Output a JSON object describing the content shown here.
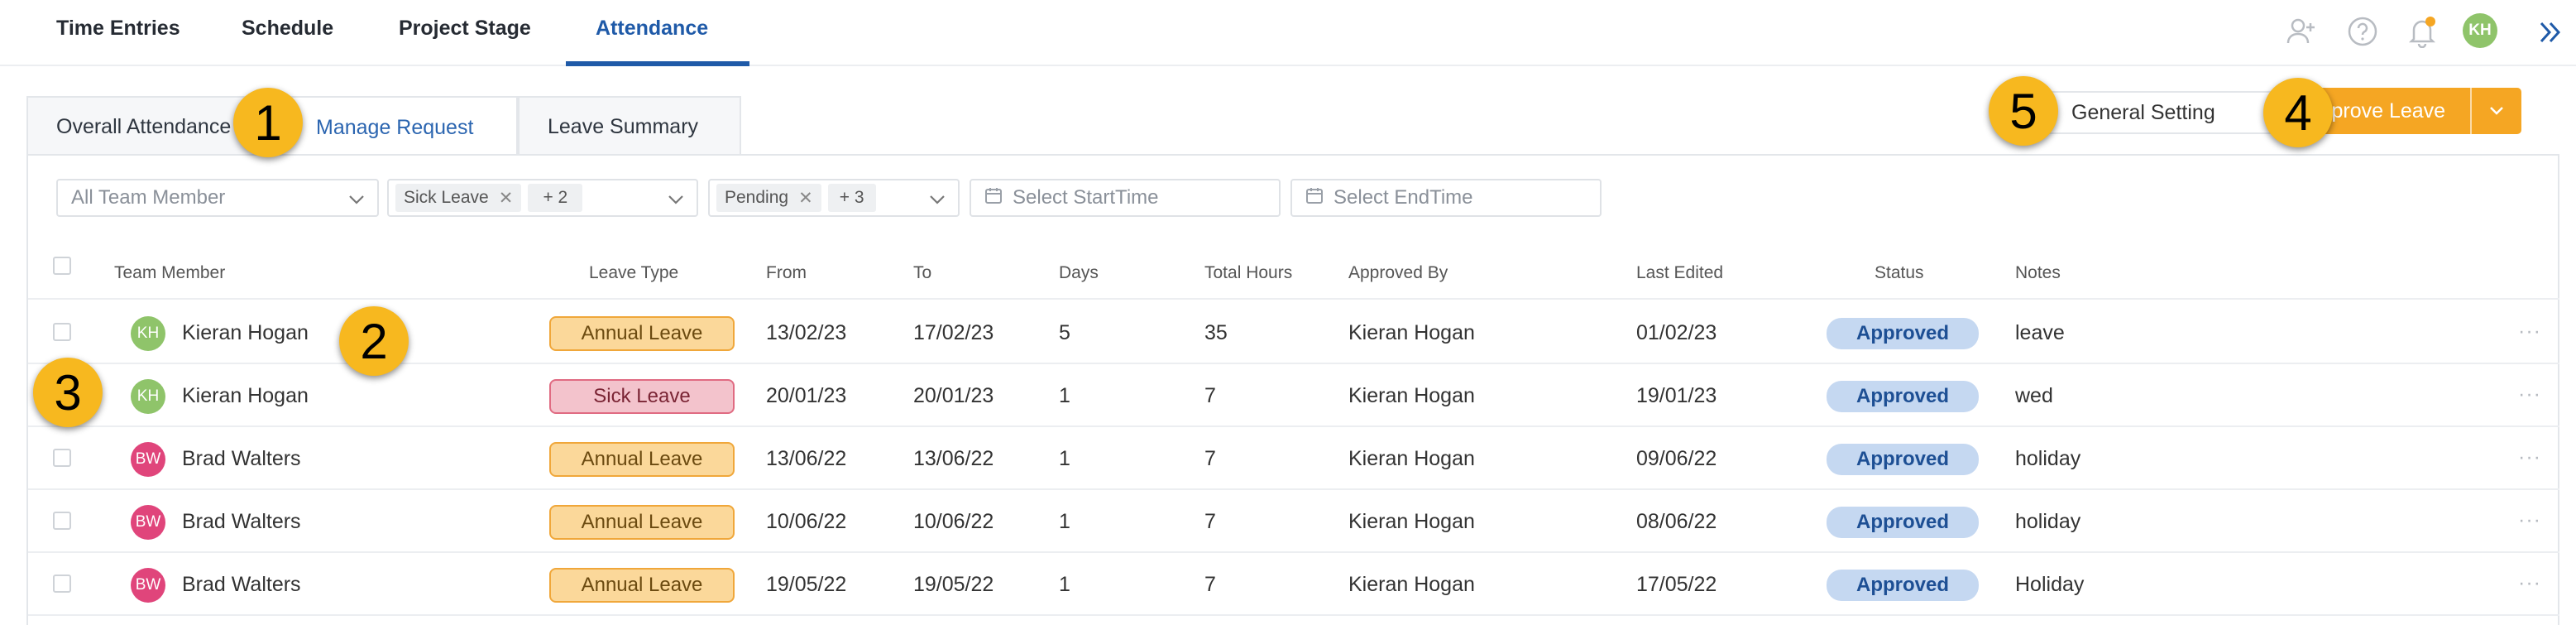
{
  "nav": {
    "items": [
      "Time Entries",
      "Schedule",
      "Project Stage",
      "Attendance"
    ],
    "active": "Attendance",
    "icons": [
      "add-user-icon",
      "help-icon",
      "bell-icon"
    ],
    "user_initials": "KH",
    "expand_icon": "double-chevron-right-icon"
  },
  "tabs": [
    "Overall Attendance",
    "Manage Request",
    "Leave Summary"
  ],
  "actions": {
    "general_setting": "General Setting",
    "approve_leave": "Approve Leave"
  },
  "filters": {
    "team_member_placeholder": "All Team Member",
    "leave_type_chip": "Sick Leave",
    "leave_type_more": "+ 2",
    "status_chip": "Pending",
    "status_more": "+ 3",
    "start_placeholder": "Select StartTime",
    "end_placeholder": "Select EndTime"
  },
  "table": {
    "headers": [
      "Team Member",
      "Leave Type",
      "From",
      "To",
      "Days",
      "Total Hours",
      "Approved By",
      "Last Edited",
      "Status",
      "Notes"
    ],
    "rows": [
      {
        "initials": "KH",
        "member": "Kieran Hogan",
        "leave_type": "Annual Leave",
        "from": "13/02/23",
        "to": "17/02/23",
        "days": "5",
        "hours": "35",
        "approved_by": "Kieran Hogan",
        "last_edited": "01/02/23",
        "status": "Approved",
        "notes": "leave"
      },
      {
        "initials": "KH",
        "member": "Kieran Hogan",
        "leave_type": "Sick Leave",
        "from": "20/01/23",
        "to": "20/01/23",
        "days": "1",
        "hours": "7",
        "approved_by": "Kieran Hogan",
        "last_edited": "19/01/23",
        "status": "Approved",
        "notes": "wed"
      },
      {
        "initials": "BW",
        "member": "Brad Walters",
        "leave_type": "Annual Leave",
        "from": "13/06/22",
        "to": "13/06/22",
        "days": "1",
        "hours": "7",
        "approved_by": "Kieran Hogan",
        "last_edited": "09/06/22",
        "status": "Approved",
        "notes": "holiday"
      },
      {
        "initials": "BW",
        "member": "Brad Walters",
        "leave_type": "Annual Leave",
        "from": "10/06/22",
        "to": "10/06/22",
        "days": "1",
        "hours": "7",
        "approved_by": "Kieran Hogan",
        "last_edited": "08/06/22",
        "status": "Approved",
        "notes": "holiday"
      },
      {
        "initials": "BW",
        "member": "Brad Walters",
        "leave_type": "Annual Leave",
        "from": "19/05/22",
        "to": "19/05/22",
        "days": "1",
        "hours": "7",
        "approved_by": "Kieran Hogan",
        "last_edited": "17/05/22",
        "status": "Approved",
        "notes": "Holiday"
      }
    ],
    "more_label": "···"
  },
  "callouts": [
    "1",
    "2",
    "3",
    "4",
    "5"
  ],
  "colors": {
    "accent": "#1f5aa8",
    "approve_button": "#f5a623",
    "annual_leave": "#fbd89a",
    "sick_leave": "#f3c3cc",
    "status_approved": "#c5d8f1",
    "avatar_kh": "#8fc46a",
    "avatar_bw": "#e0457b",
    "callout": "#f7b81f"
  }
}
